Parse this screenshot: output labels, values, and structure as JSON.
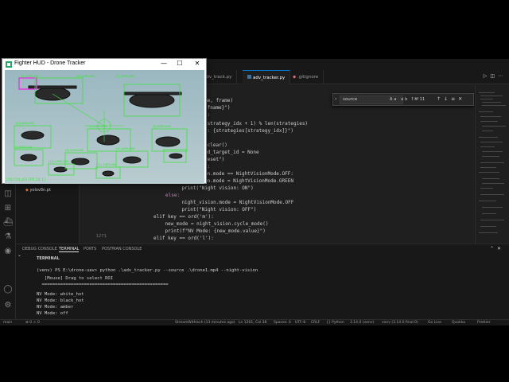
{
  "hud_window": {
    "title": "Fighter HUD - Drone Tracker",
    "controls": [
      "—",
      "☐",
      "✕"
    ],
    "status_left": "[VS:CHL:JOI FPS:24.1]",
    "detections": [
      "[1] AIRPLANE",
      "[2] AIRPLANE",
      "[3] AIRPLANE",
      "[4] AIRPLANE",
      "[5] AIRPLANE",
      "[6] AIRPLANE",
      "[7] AIRPLANE",
      "[8] AIRPLANE",
      "[9] AIRPLANE",
      "[10] AIRPLANE",
      "[11] AIRPLANE",
      "[12] AIRPLANE",
      "[13] AIRPLANE",
      "[14] AIRPLANE"
    ]
  },
  "tabs": [
    {
      "label": "adv_track.py",
      "active": false,
      "color": "#3572A5"
    },
    {
      "label": "adv_tracker.py",
      "active": true,
      "color": "#3572A5"
    },
    {
      "label": ".gitignore",
      "active": false,
      "color": "#e06c75"
    }
  ],
  "sidebar": {
    "files": [
      "yolov8n.pt"
    ]
  },
  "find_widget": {
    "query": "source",
    "options": "Aa ab .*",
    "count": "? of 11"
  },
  "code_lines": [
    {
      "num": "",
      "text": "me, frame)"
    },
    {
      "num": "",
      "text": "{fname}\")"
    },
    {
      "num": "",
      "text": "):"
    },
    {
      "num": "",
      "text": "(strategy_idx + 1) % len(strategies)"
    },
    {
      "num": "",
      "text": "y: {strategies[strategy_idx]}\")"
    },
    {
      "num": "",
      "text": ""
    },
    {
      "num": "",
      "text": ".clear()"
    },
    {
      "num": "",
      "text": "ed_target_id = None"
    },
    {
      "num": "",
      "text": "reset\")"
    },
    {
      "num": "",
      "text": "):"
    },
    {
      "num": "",
      "text": "on.mode == NightVisionMode.OFF:"
    },
    {
      "num": "",
      "text": "on.mode = NightVisionMode.GREEN"
    },
    {
      "num": "",
      "text": "    print(\"Night vision: ON\")"
    },
    {
      "num": "",
      "text": "else:"
    },
    {
      "num": "",
      "text": "    night_vision.mode = NightVisionMode.OFF"
    },
    {
      "num": "",
      "text": "    print(\"Night vision: OFF\")"
    },
    {
      "num": "",
      "text": "elif key == ord('m'):"
    },
    {
      "num": "",
      "text": "    new_mode = night_vision.cycle_mode()"
    },
    {
      "num": "",
      "text": "    print(f\"NV Mode: {new_mode.value}\")"
    },
    {
      "num": "1271",
      "text": "elif key == ord('l'):"
    }
  ],
  "panel": {
    "tabs": [
      "DEBUG CONSOLE",
      "TERMINAL",
      "PORTS",
      "POSTMAN CONSOLE"
    ],
    "active_tab": "TERMINAL",
    "terminal_header": "TERMINAL",
    "lines": [
      "(venv) PS E:\\drone-uav> python .\\adv_tracker.py --source .\\drone1.mp4 --night-vision",
      "   [Mouse] Drag to select ROI",
      "  ================================================",
      "",
      "NV Mode: white_hot",
      "NV Mode: black_hot",
      "NV Mode: amber",
      "NV Mode: off"
    ]
  },
  "statusbar": {
    "left": [
      "main",
      "⊗ 0 ⚠ 0"
    ],
    "right": [
      "StreamWithlsch (13 minutes ago)",
      "Ln 1261, Col 38",
      "Spaces: 4",
      "UTF-8",
      "CRLF",
      "{} Python",
      "3.14.0 (venv)",
      "venv (3.14.0 final:0)",
      "Go Live",
      "Quokka",
      "Prettier"
    ]
  }
}
